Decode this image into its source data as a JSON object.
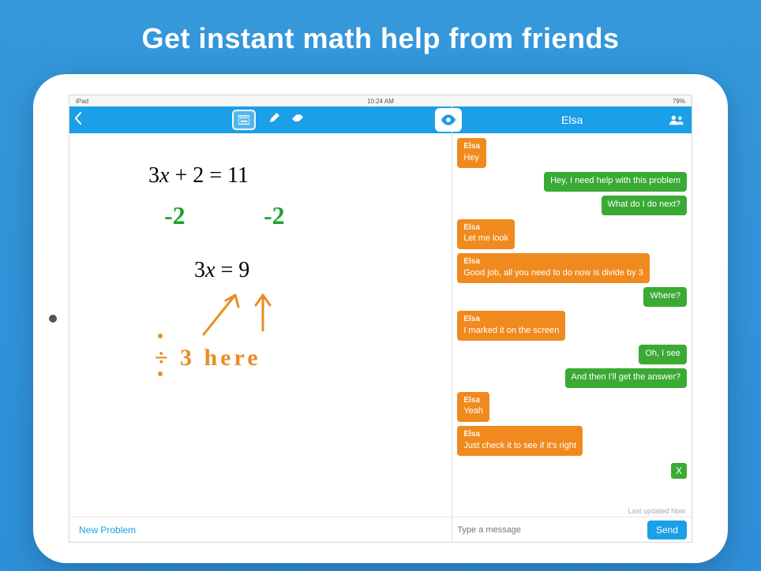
{
  "headline": "Get instant math help from friends",
  "status": {
    "left": "iPad",
    "center": "10:24 AM",
    "right": "79%"
  },
  "whiteboard": {
    "equation1": "3x + 2 = 11",
    "annotation_minus_a": "-2",
    "annotation_minus_b": "-2",
    "equation2": "3x = 9",
    "annotation_divide": "÷ 3  here",
    "footer_new_problem": "New Problem"
  },
  "chat": {
    "header_name": "Elsa",
    "input_placeholder": "Type a message",
    "send_label": "Send",
    "last_updated": "Last updated  Now",
    "messages": [
      {
        "side": "friend",
        "sender": "Elsa",
        "text": "Hey"
      },
      {
        "side": "me",
        "text": "Hey, I need help with this problem"
      },
      {
        "side": "me",
        "text": "What do I do next?"
      },
      {
        "side": "friend",
        "sender": "Elsa",
        "text": "Let me look"
      },
      {
        "side": "friend",
        "sender": "Elsa",
        "text": "Good job, all you need to do now is divide by 3"
      },
      {
        "side": "me",
        "text": "Where?"
      },
      {
        "side": "friend",
        "sender": "Elsa",
        "text": "I marked it on the screen"
      },
      {
        "side": "me",
        "text": "Oh, I see"
      },
      {
        "side": "me",
        "text": "And then I'll get the answer?"
      },
      {
        "side": "friend",
        "sender": "Elsa",
        "text": "Yeah"
      },
      {
        "side": "friend",
        "sender": "Elsa",
        "text": "Just check it to see if it's right"
      }
    ],
    "close_label": "X"
  }
}
